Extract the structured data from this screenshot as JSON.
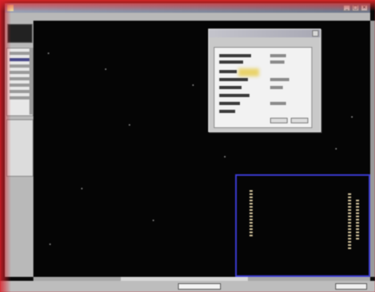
{
  "window": {
    "title": "",
    "menu": [
      "",
      "",
      "",
      "",
      "",
      ""
    ]
  },
  "dialog": {
    "title": "",
    "text": ""
  },
  "selection": {
    "caption": ""
  },
  "statusbar": {
    "coords": "",
    "mode": "",
    "document": "",
    "field": ""
  },
  "colors": {
    "accent": "#3a3ad0",
    "highlight": "#e9d36a",
    "border_red": "#c8202a"
  },
  "icons": [
    "app-icon",
    "minimize-icon",
    "maximize-icon",
    "close-icon",
    "toolbox-icon",
    "dialog-close-icon"
  ]
}
